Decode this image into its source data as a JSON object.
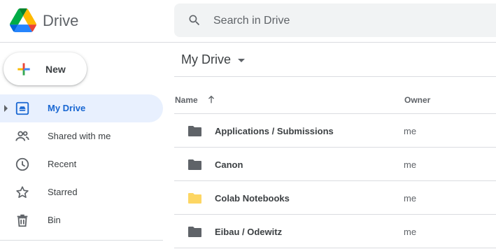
{
  "app": {
    "name": "Drive"
  },
  "search": {
    "placeholder": "Search in Drive"
  },
  "new_button": {
    "label": "New"
  },
  "sidebar": {
    "items": [
      {
        "label": "My Drive",
        "icon": "my-drive-icon",
        "active": true
      },
      {
        "label": "Shared with me",
        "icon": "shared-icon",
        "active": false
      },
      {
        "label": "Recent",
        "icon": "clock-icon",
        "active": false
      },
      {
        "label": "Starred",
        "icon": "star-icon",
        "active": false
      },
      {
        "label": "Bin",
        "icon": "trash-icon",
        "active": false
      }
    ]
  },
  "main": {
    "title": "My Drive",
    "columns": {
      "name": "Name",
      "owner": "Owner"
    },
    "files": [
      {
        "name": "Applications / Submissions",
        "owner": "me",
        "icon": "folder-icon",
        "color": "#5f6368"
      },
      {
        "name": "Canon",
        "owner": "me",
        "icon": "folder-icon",
        "color": "#5f6368"
      },
      {
        "name": "Colab Notebooks",
        "owner": "me",
        "icon": "folder-icon",
        "color": "#fdd663"
      },
      {
        "name": "Eibau / Odewitz",
        "owner": "me",
        "icon": "folder-icon",
        "color": "#5f6368"
      }
    ]
  },
  "colors": {
    "accent": "#1967d2",
    "active_bg": "#e8f0fe",
    "search_bg": "#f1f3f4"
  }
}
